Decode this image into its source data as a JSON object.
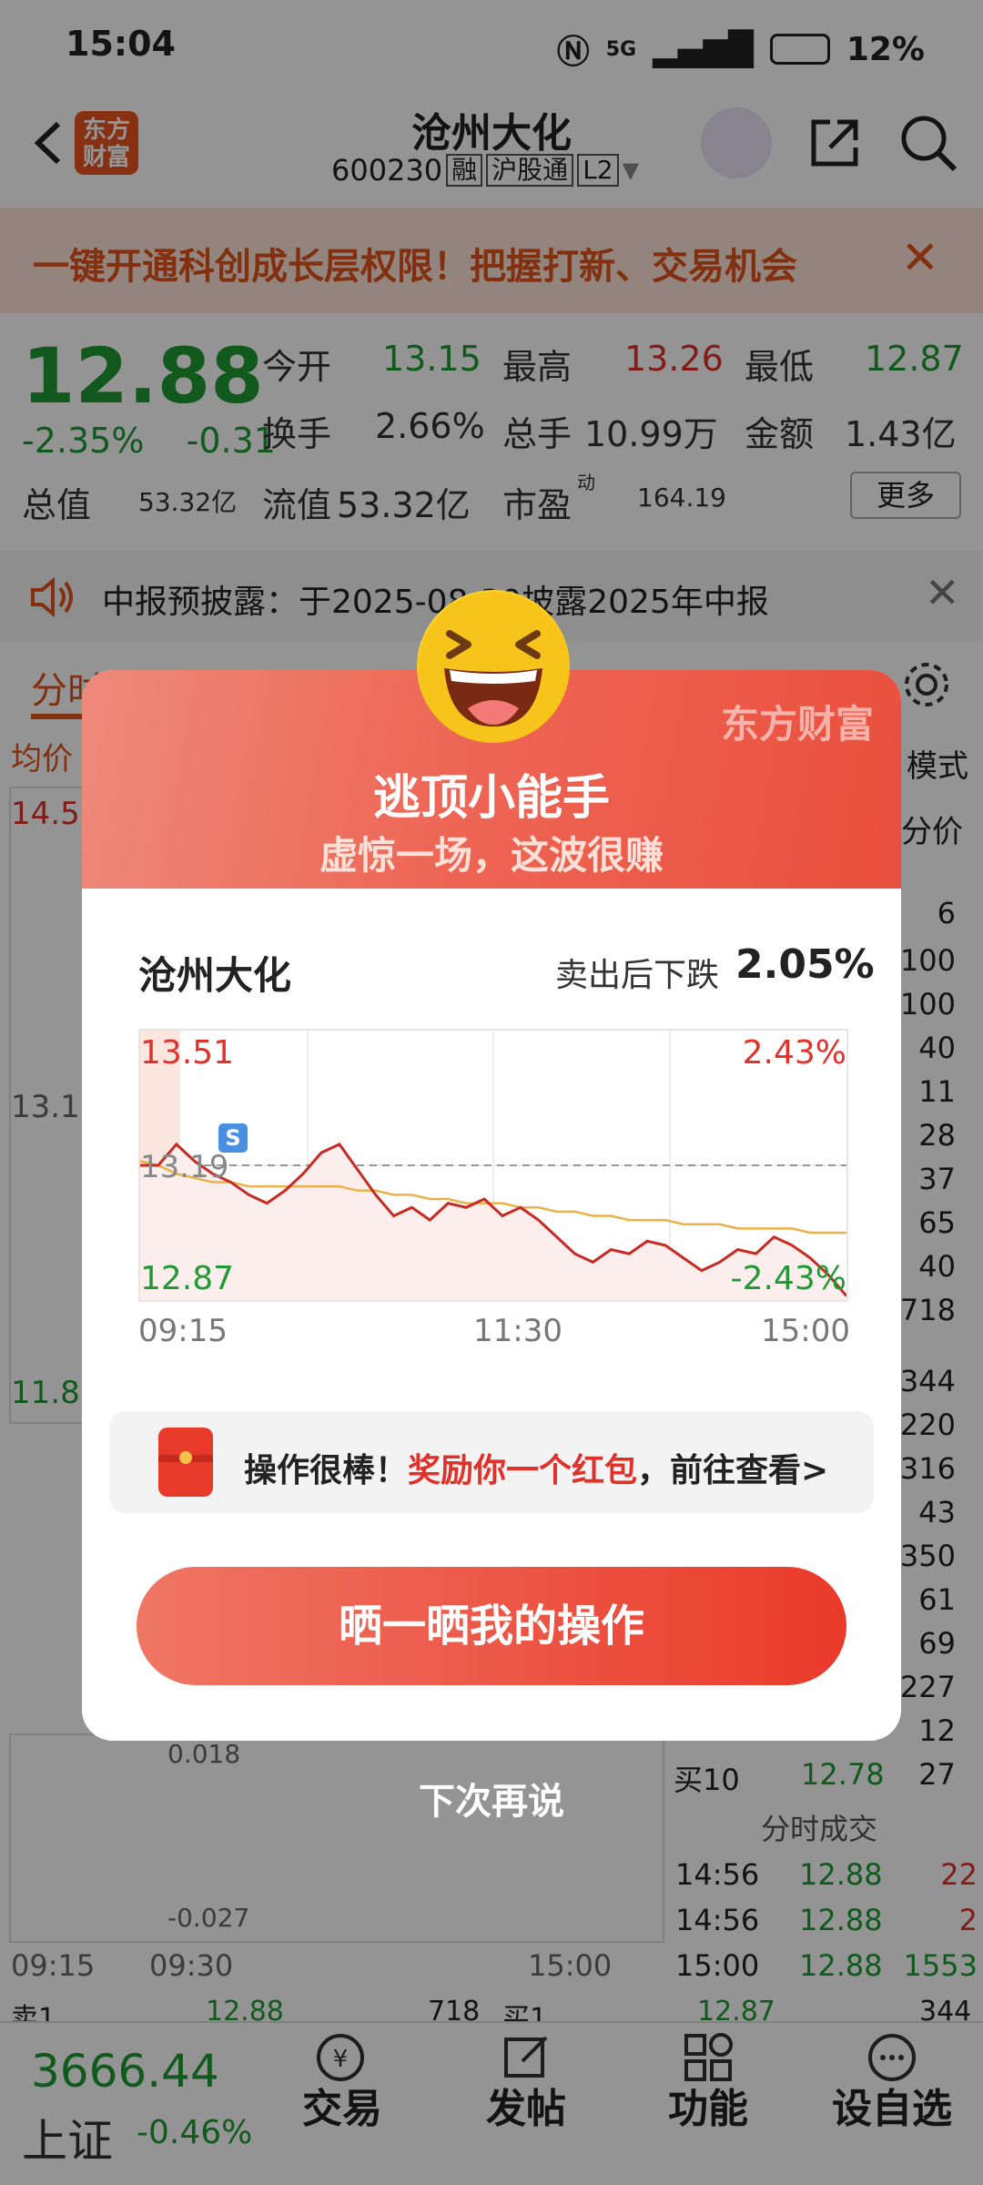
{
  "status": {
    "time": "15:04",
    "network": "5G",
    "battery": "12%"
  },
  "header": {
    "logo": "东方财富",
    "stock_name": "沧州大化",
    "stock_code": "600230",
    "tags": [
      "融",
      "沪股通",
      "L2"
    ]
  },
  "banner": {
    "text": "一键开通科创成长层权限！把握打新、交易机会"
  },
  "quote": {
    "price": "12.88",
    "change_pct": "-2.35%",
    "change_abs": "-0.31",
    "fields": [
      {
        "label": "今开",
        "value": "13.15"
      },
      {
        "label": "最高",
        "value": "13.26"
      },
      {
        "label": "最低",
        "value": "12.87"
      },
      {
        "label": "换手",
        "value": "2.66%"
      },
      {
        "label": "总手",
        "value": "10.99万"
      },
      {
        "label": "金额",
        "value": "1.43亿"
      },
      {
        "label": "总值",
        "value": "53.32亿"
      },
      {
        "label": "流值",
        "value": "53.32亿"
      },
      {
        "label": "市盈",
        "sup": "动",
        "value": "164.19"
      }
    ],
    "more_label": "更多"
  },
  "notice": {
    "text": "中报预披露：于2025-08-30披露2025年中报"
  },
  "background": {
    "tab_first": "分时",
    "avg_label": "均价",
    "mode_label": "模式",
    "fen_jia": "分价",
    "y_top": "14.5",
    "y_mid": "13.1",
    "y_low": "11.8",
    "macd_top": "0.018",
    "macd_bottom": "-0.027",
    "time_labels": [
      "09:15",
      "09:30",
      "15:00"
    ],
    "order_book_sizes": [
      "6",
      "100",
      "100",
      "40",
      "11",
      "28",
      "37",
      "65",
      "40",
      "718",
      "344",
      "220",
      "316",
      "43",
      "350",
      "61",
      "69",
      "227",
      "12",
      "27"
    ],
    "buy10_label": "买10",
    "buy10_price": "12.78",
    "buy10_size": "27",
    "trade_title": "分时成交",
    "trades": [
      {
        "time": "14:56",
        "price": "12.88",
        "vol": "22"
      },
      {
        "time": "14:56",
        "price": "12.88",
        "vol": "2"
      },
      {
        "time": "15:00",
        "price": "12.88",
        "vol": "1553"
      }
    ],
    "sell1": {
      "label": "卖1",
      "price": "12.88",
      "vol": "718"
    },
    "buy1": {
      "label": "买1",
      "price": "12.87",
      "vol": "344"
    }
  },
  "bottom_nav": {
    "index_value": "3666.44",
    "index_name": "上证",
    "index_change": "-0.46%",
    "items": [
      "交易",
      "发帖",
      "功能",
      "设自选"
    ]
  },
  "modal": {
    "brand_watermark": "东方财富",
    "title": "逃顶小能手",
    "subtitle": "虚惊一场，这波很赚",
    "stock_name": "沧州大化",
    "drop_label": "卖出后下跌",
    "drop_value": "2.05%",
    "chart_high": "13.51",
    "chart_high_pct": "2.43%",
    "chart_low": "12.87",
    "chart_low_pct": "-2.43%",
    "chart_ref": "13.19",
    "sell_marker": "S",
    "time_start": "09:15",
    "time_mid": "11:30",
    "time_end": "15:00",
    "reward_prefix": "操作很棒！",
    "reward_highlight": "奖励你一个红包",
    "reward_suffix": "，前往查看>",
    "share_button": "晒一晒我的操作",
    "dismiss": "下次再说"
  },
  "chart_data": {
    "type": "line",
    "ylim": [
      12.87,
      13.51
    ],
    "series": [
      {
        "values": [
          13.19,
          13.19,
          13.24,
          13.2,
          13.17,
          13.15,
          13.12,
          13.1,
          13.13,
          13.17,
          13.22,
          13.24,
          13.18,
          13.12,
          13.07,
          13.09,
          13.06,
          13.1,
          13.09,
          13.11,
          13.07,
          13.09,
          13.06,
          13.02,
          12.98,
          12.96,
          12.99,
          12.98,
          13.01,
          13.0,
          12.97,
          12.94,
          12.96,
          12.99,
          12.98,
          13.02,
          13.0,
          12.97,
          12.93,
          12.88
        ]
      },
      {
        "values": [
          13.2,
          13.19,
          13.17,
          13.16,
          13.15,
          13.15,
          13.14,
          13.14,
          13.14,
          13.14,
          13.14,
          13.14,
          13.13,
          13.13,
          13.12,
          13.12,
          13.11,
          13.11,
          13.1,
          13.1,
          13.1,
          13.09,
          13.09,
          13.08,
          13.08,
          13.07,
          13.07,
          13.06,
          13.06,
          13.06,
          13.05,
          13.05,
          13.05,
          13.04,
          13.04,
          13.04,
          13.04,
          13.03,
          13.03,
          13.03
        ]
      }
    ]
  }
}
